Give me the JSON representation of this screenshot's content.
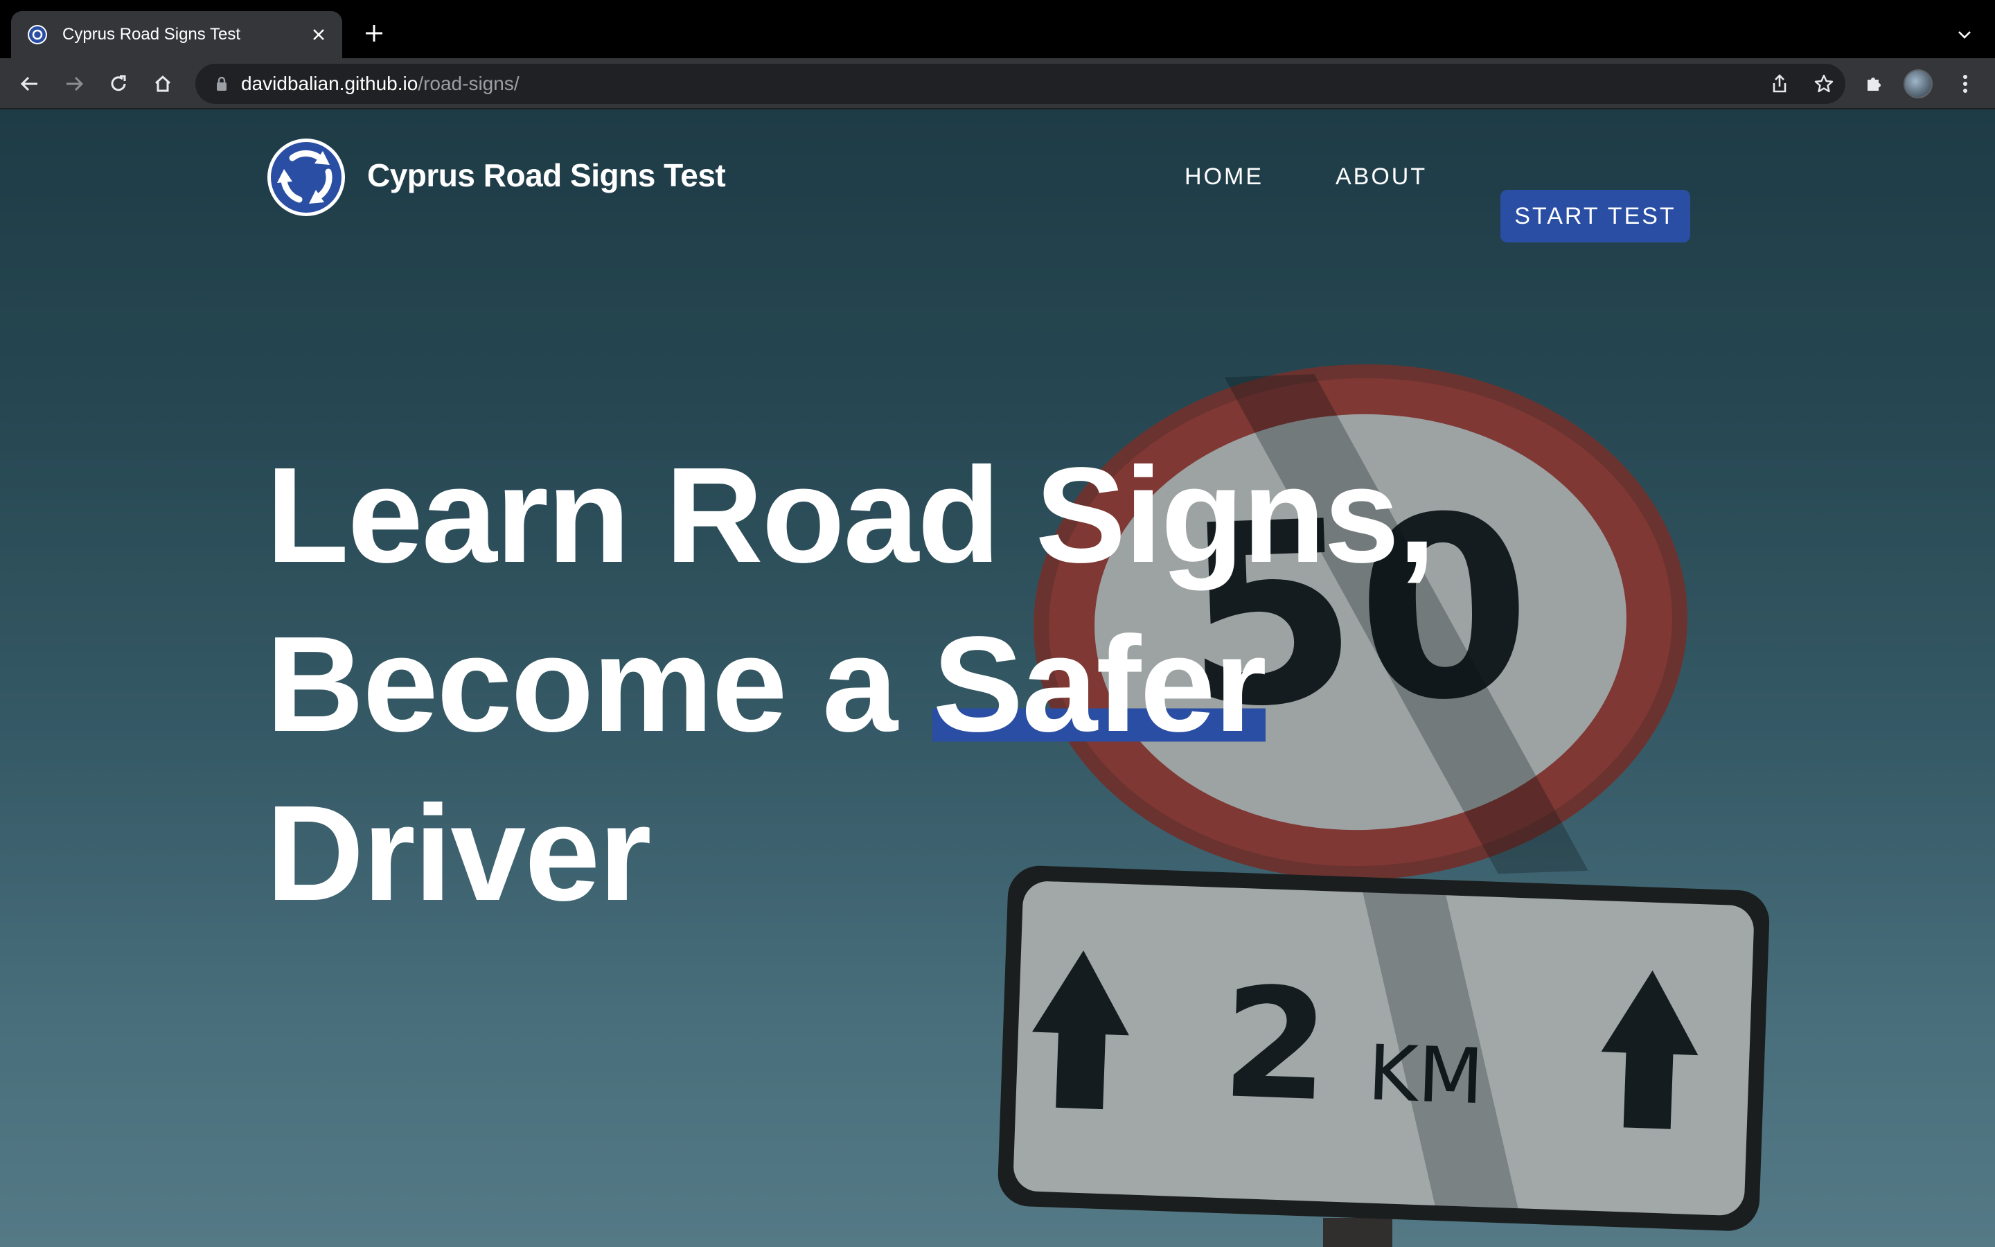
{
  "browser": {
    "tab": {
      "title": "Cyprus Road Signs Test"
    },
    "address_bar": {
      "domain": "davidbalian.github.io",
      "path": "/road-signs/"
    },
    "icons": {
      "back": "arrow-left-icon",
      "forward": "arrow-right-icon",
      "reload": "reload-icon",
      "home": "home-icon",
      "share": "share-icon",
      "bookmark": "star-icon",
      "extensions": "puzzle-icon",
      "menu": "kebab-menu-icon"
    }
  },
  "site": {
    "brand": "Cyprus Road Signs Test",
    "nav": {
      "home": "HOME",
      "about": "ABOUT",
      "start": "START TEST"
    },
    "colors": {
      "accent": "#2a4ea3"
    }
  },
  "hero": {
    "line1": "Learn Road Signs,",
    "line2_pre": "Become a ",
    "line2_highlight": "Safer",
    "line3": "Driver"
  },
  "background": {
    "speed_sign_number": "50",
    "plate_distance": "2",
    "plate_unit": "KM"
  }
}
